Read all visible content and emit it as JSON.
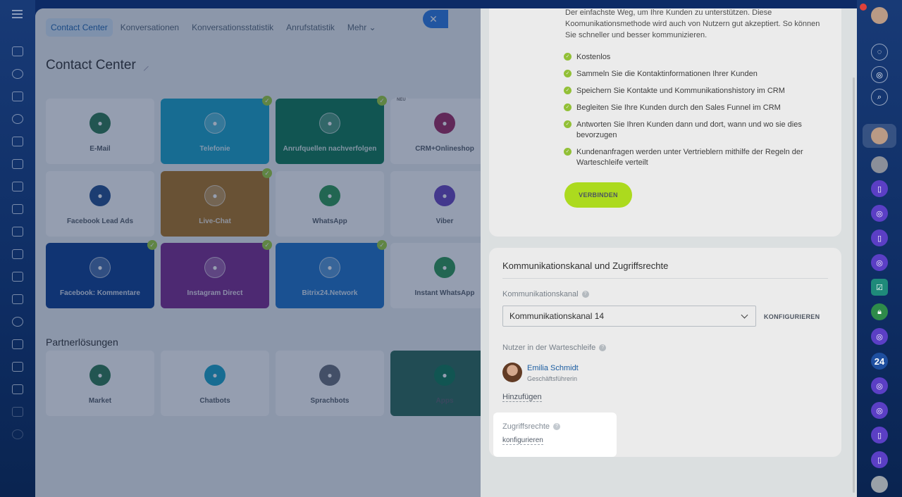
{
  "tabs": [
    {
      "label": "Contact Center"
    },
    {
      "label": "Konversationen"
    },
    {
      "label": "Konversationsstatistik"
    },
    {
      "label": "Anrufstatistik"
    },
    {
      "label": "Mehr ⌄"
    }
  ],
  "page_title": "Contact Center",
  "tiles": [
    {
      "label": "E-Mail",
      "color": "#2f7a52",
      "checked": false
    },
    {
      "label": "Telefonie",
      "color": "#1aa4c8",
      "checked": true
    },
    {
      "label": "Anrufquellen nachverfolgen",
      "color": "#0f7a55",
      "checked": true
    },
    {
      "label": "CRM+Onlineshop",
      "color": "#a02b62",
      "checked": false,
      "badge": "NEU"
    },
    {
      "label": "Facebook Lead Ads",
      "color": "#234f8e",
      "checked": false
    },
    {
      "label": "Live-Chat",
      "color": "#b0761f",
      "checked": true
    },
    {
      "label": "WhatsApp",
      "color": "#2e9a55",
      "checked": false
    },
    {
      "label": "Viber",
      "color": "#6a45bf",
      "checked": false
    },
    {
      "label": "Facebook: Kommentare",
      "color": "#0e3f90",
      "checked": true
    },
    {
      "label": "Instagram Direct",
      "color": "#7c2a8f",
      "checked": true
    },
    {
      "label": "Bitrix24.Network",
      "color": "#1f74c8",
      "checked": true
    },
    {
      "label": "Instant WhatsApp",
      "color": "#2e9a55",
      "checked": false
    }
  ],
  "partner_section_title": "Partnerlösungen",
  "partner_tiles": [
    {
      "label": "Market"
    },
    {
      "label": "Chatbots"
    },
    {
      "label": "Sprachbots"
    },
    {
      "label": "Apps"
    }
  ],
  "slider": {
    "intro": "Der einfachste Weg, um Ihre Kunden zu unterstützen. Diese Koomunikationsmethode wird auch von Nutzern gut akzeptiert. So können Sie schneller und besser kommunizieren.",
    "features": [
      "Kostenlos",
      "Sammeln Sie die Kontaktinformationen Ihrer Kunden",
      "Speichern Sie Kontakte und Kommunikationshistory im CRM",
      "Begleiten Sie Ihre Kunden durch den Sales Funnel im CRM",
      "Antworten Sie Ihren Kunden dann und dort, wann und wo sie dies bevorzugen",
      "Kundenanfragen werden unter Vertrieblern mithilfe der Regeln der Warteschleife verteilt"
    ],
    "connect_label": "VERBINDEN",
    "card2_title": "Kommunikationskanal und Zugriffsrechte",
    "channel_label": "Kommunikationskanal",
    "channel_value": "Kommunikationskanal 14",
    "configure_button": "KONFIGURIEREN",
    "queue_label": "Nutzer in der Warteschleife",
    "user_name": "Emilia Schmidt",
    "user_role": "Geschäftsführerin",
    "add_link": "Hinzufügen",
    "access_label": "Zugriffsrechte",
    "access_link": "konfigurieren"
  },
  "right_rail": {
    "counter_label": "24"
  }
}
